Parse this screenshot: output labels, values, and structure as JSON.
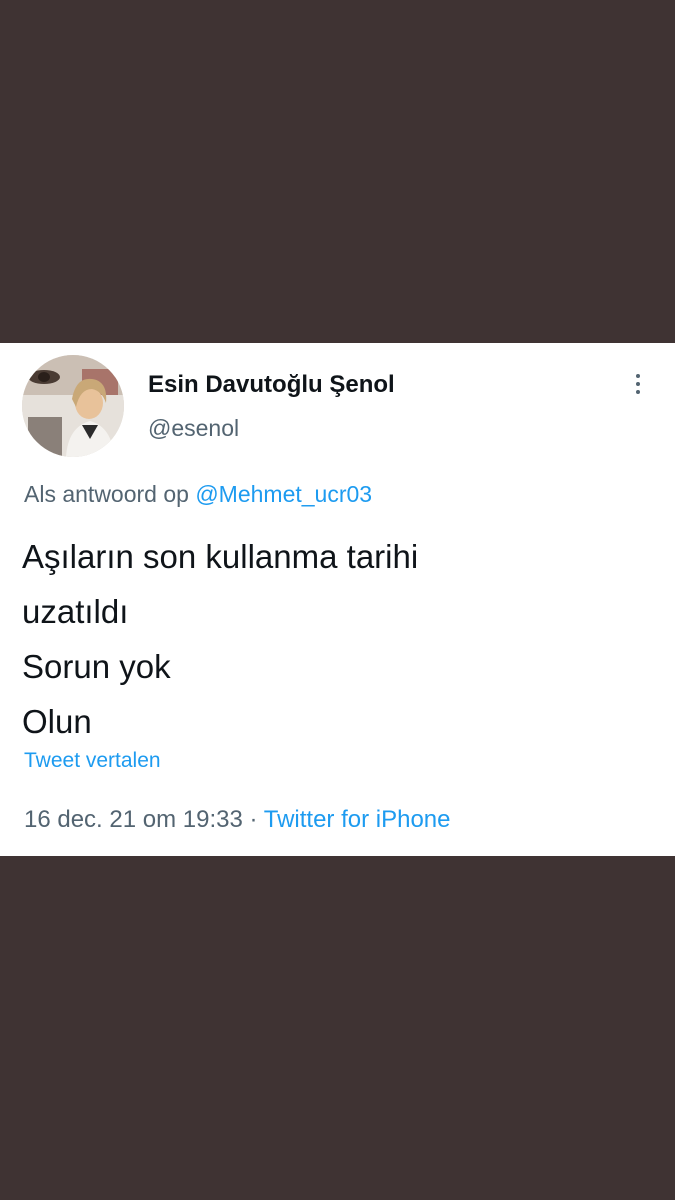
{
  "tweet": {
    "author": {
      "display_name": "Esin Davutoğlu Şenol",
      "handle": "@esenol",
      "avatar_icon": "user-avatar-photo"
    },
    "more_icon": "vertical-ellipsis-icon",
    "reply_prefix": "Als antwoord op",
    "reply_to": "@Mehmet_ucr03",
    "text_lines": [
      "Aşıların son kullanma tarihi",
      "uzatıldı",
      "Sorun yok",
      "Olun"
    ],
    "translate_label": "Tweet vertalen",
    "timestamp": "16 dec. 21 om 19:33",
    "separator": "·",
    "source": "Twitter for iPhone"
  },
  "colors": {
    "page_background": "#3f3333",
    "card_background": "#ffffff",
    "text_primary": "#0f1419",
    "text_secondary": "#536471",
    "link": "#1d9bf0"
  }
}
